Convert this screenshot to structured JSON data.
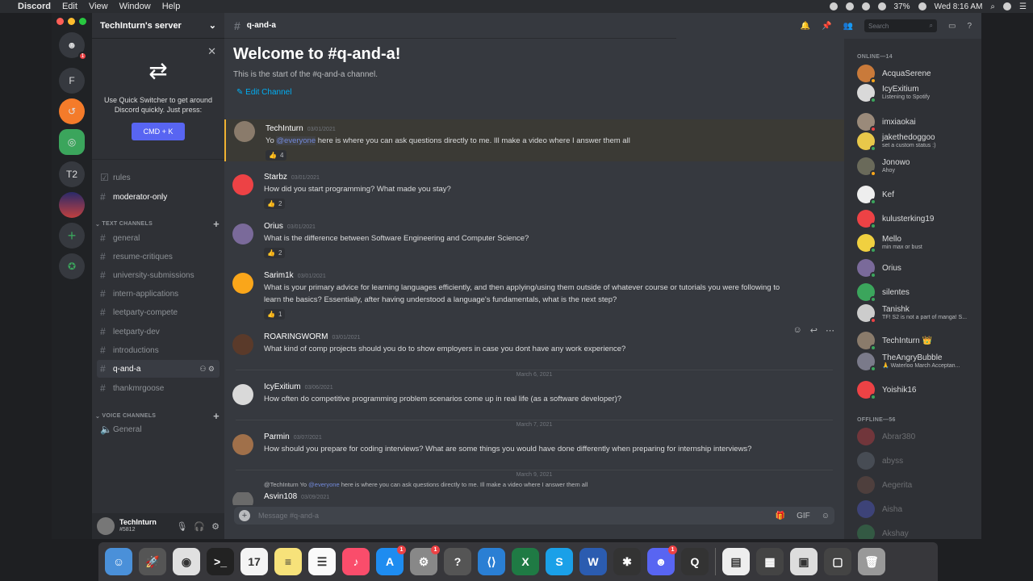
{
  "menubar": {
    "app": "Discord",
    "items": [
      "Edit",
      "View",
      "Window",
      "Help"
    ],
    "battery": "37%",
    "clock": "Wed 8:16 AM"
  },
  "rail": {
    "servers": [
      {
        "label": "",
        "badge": "1",
        "color": "#36393f"
      },
      {
        "label": "F",
        "badge": "",
        "color": "#36393f"
      },
      {
        "label": "",
        "badge": "",
        "color": "#f47b2a"
      },
      {
        "label": "",
        "badge": "",
        "color": "#3ba55c"
      },
      {
        "label": "T2",
        "badge": "",
        "color": "#36393f"
      },
      {
        "label": "",
        "badge": "",
        "color": "#b23a48"
      }
    ]
  },
  "sidebar": {
    "server_name": "TechInturn's server",
    "quick_switcher": {
      "text": "Use Quick Switcher to get around Discord quickly. Just press:",
      "button": "CMD + K"
    },
    "top_channels": [
      {
        "name": "rules"
      },
      {
        "name": "moderator-only"
      }
    ],
    "text_category": "TEXT CHANNELS",
    "text_channels": [
      {
        "name": "general"
      },
      {
        "name": "resume-critiques"
      },
      {
        "name": "university-submissions"
      },
      {
        "name": "intern-applications"
      },
      {
        "name": "leetparty-compete"
      },
      {
        "name": "leetparty-dev"
      },
      {
        "name": "introductions"
      },
      {
        "name": "q-and-a"
      },
      {
        "name": "thankmrgoose"
      }
    ],
    "voice_category": "VOICE CHANNELS",
    "voice_channels": [
      {
        "name": "General"
      }
    ],
    "user": {
      "name": "TechInturn",
      "tag": "#5812"
    }
  },
  "chat": {
    "channel": "q-and-a",
    "welcome_title": "Welcome to #q-and-a!",
    "welcome_sub": "This is the start of the #q-and-a channel.",
    "edit_channel": "Edit Channel",
    "messages": [
      {
        "author": "TechInturn",
        "date": "03/01/2021",
        "pre": "Yo ",
        "mention": "@everyone",
        "text": " here is where you can ask questions directly to me. Ill make a video where I answer them all",
        "reaction": "4",
        "avatar": "#8a7b6b"
      },
      {
        "author": "Starbz",
        "date": "03/01/2021",
        "pre": "",
        "mention": "",
        "text": "How did you start programming? What made you stay?",
        "reaction": "2",
        "avatar": "#ed4245"
      },
      {
        "author": "Orius",
        "date": "03/01/2021",
        "pre": "",
        "mention": "",
        "text": "What is the difference between Software Engineering and Computer Science?",
        "reaction": "2",
        "avatar": "#7a6a9a"
      },
      {
        "author": "Sarim1k",
        "date": "03/01/2021",
        "pre": "",
        "mention": "",
        "text": "What is your primary advice for learning languages efficiently, and then applying/using them outside of whatever course or tutorials you were following to learn the basics? Essentially, after having understood a language's fundamentals, what is the next step?",
        "reaction": "1",
        "avatar": "#faa61a"
      },
      {
        "author": "ROARINGWORM",
        "date": "03/01/2021",
        "pre": "",
        "mention": "",
        "text": "What kind of comp projects should you do to show employers in case you dont have any work experience?",
        "reaction": "",
        "avatar": "#5a3a2a"
      },
      {
        "author": "IcyExitium",
        "date": "03/06/2021",
        "pre": "",
        "mention": "",
        "text": "How often do competitive programming problem scenarios come up in real life (as a software developer)?",
        "reaction": "",
        "avatar": "#d9d9d9"
      },
      {
        "author": "Parmin",
        "date": "03/07/2021",
        "pre": "",
        "mention": "",
        "text": "How should you prepare for coding interviews? What are some things you would have done differently when preparing for internship interviews?",
        "reaction": "",
        "avatar": "#a0704a"
      },
      {
        "author": "Asvin108",
        "date": "03/09/2021",
        "pre": "",
        "mention": "",
        "text": "",
        "reaction": "",
        "avatar": "#6a6a6a"
      }
    ],
    "dividers": [
      "March 6, 2021",
      "March 7, 2021",
      "March 9, 2021"
    ],
    "reply_preview": {
      "author": "@TechInturn",
      "pre": " Yo ",
      "mention": "@everyone",
      "text": " here is where you can ask questions directly to me. Ill make a video where I answer them all"
    },
    "composer_placeholder": "Message #q-and-a"
  },
  "header_tools": {
    "search_placeholder": "Search"
  },
  "members": {
    "online_label": "ONLINE—14",
    "online": [
      {
        "name": "AcquaSerene",
        "status": "",
        "color": "#c97a3a",
        "dot": "#faa61a"
      },
      {
        "name": "IcyExitium",
        "status": "Listening to Spotify",
        "color": "#d9d9d9",
        "dot": "#3ba55c"
      },
      {
        "name": "imxiaokai",
        "status": "",
        "color": "#9a8a7a",
        "dot": "#ed4245"
      },
      {
        "name": "jakethedoggoo",
        "status": "set a custom status :)",
        "color": "#e8c84a",
        "dot": "#3ba55c"
      },
      {
        "name": "Jonowo",
        "status": "Ahoy",
        "color": "#6a6a5a",
        "dot": "#faa61a"
      },
      {
        "name": "Kef",
        "status": "",
        "color": "#eeeeee",
        "dot": "#3ba55c"
      },
      {
        "name": "kulusterking19",
        "status": "",
        "color": "#ed4245",
        "dot": "#3ba55c"
      },
      {
        "name": "Mello",
        "status": "min max or bust",
        "color": "#f0d040",
        "dot": "#3ba55c"
      },
      {
        "name": "Orius",
        "status": "",
        "color": "#7a6a9a",
        "dot": "#3ba55c"
      },
      {
        "name": "silentes",
        "status": "",
        "color": "#3ba55c",
        "dot": "#3ba55c"
      },
      {
        "name": "Tanishk",
        "status": "TF! S2 is not a part of manga! S...",
        "color": "#cccccc",
        "dot": "#ed4245"
      },
      {
        "name": "TechInturn 👑",
        "status": "",
        "color": "#8a7b6b",
        "dot": "#3ba55c"
      },
      {
        "name": "TheAngryBubble",
        "status": "🙏 Waterloo March Acceptan...",
        "color": "#7a7a8a",
        "dot": "#3ba55c"
      },
      {
        "name": "Yoishik16",
        "status": "",
        "color": "#ed4245",
        "dot": "#3ba55c"
      }
    ],
    "offline_label": "OFFLINE—56",
    "offline": [
      {
        "name": "Abrar380",
        "color": "#ed4245"
      },
      {
        "name": "abyss",
        "color": "#747f8d"
      },
      {
        "name": "Aegerita",
        "color": "#8a5a4a"
      },
      {
        "name": "Aisha",
        "color": "#5865f2"
      },
      {
        "name": "Akshay",
        "color": "#3ba55c"
      }
    ]
  },
  "dock": {
    "apps": [
      {
        "name": "finder-icon",
        "color": "#4a90d9",
        "glyph": "☺",
        "badge": ""
      },
      {
        "name": "launchpad-icon",
        "color": "#555",
        "glyph": "🚀",
        "badge": ""
      },
      {
        "name": "chrome-icon",
        "color": "#e0e0e0",
        "glyph": "◉",
        "badge": ""
      },
      {
        "name": "terminal-icon",
        "color": "#222",
        "glyph": ">_",
        "badge": ""
      },
      {
        "name": "calendar-icon",
        "color": "#f4f4f4",
        "glyph": "17",
        "badge": ""
      },
      {
        "name": "notes-icon",
        "color": "#f7e27a",
        "glyph": "≡",
        "badge": ""
      },
      {
        "name": "reminders-icon",
        "color": "#fafafa",
        "glyph": "☰",
        "badge": ""
      },
      {
        "name": "music-icon",
        "color": "#fa4d6b",
        "glyph": "♪",
        "badge": ""
      },
      {
        "name": "app-store-icon",
        "color": "#1e8cf0",
        "glyph": "A",
        "badge": "1"
      },
      {
        "name": "system-preferences-icon",
        "color": "#888",
        "glyph": "⚙",
        "badge": "1"
      },
      {
        "name": "help-icon",
        "color": "#555",
        "glyph": "?",
        "badge": ""
      },
      {
        "name": "vscode-icon",
        "color": "#2a7fd4",
        "glyph": "⟨⟩",
        "badge": ""
      },
      {
        "name": "excel-icon",
        "color": "#1f7a44",
        "glyph": "X",
        "badge": ""
      },
      {
        "name": "skype-icon",
        "color": "#1aa0e8",
        "glyph": "S",
        "badge": ""
      },
      {
        "name": "word-icon",
        "color": "#2b5cb0",
        "glyph": "W",
        "badge": ""
      },
      {
        "name": "davinci-icon",
        "color": "#333",
        "glyph": "✱",
        "badge": ""
      },
      {
        "name": "discord-icon",
        "color": "#5865f2",
        "glyph": "☻",
        "badge": "1"
      },
      {
        "name": "quicktime-icon",
        "color": "#333",
        "glyph": "Q",
        "badge": ""
      },
      {
        "name": "document-icon",
        "color": "#eee",
        "glyph": "▤",
        "badge": ""
      },
      {
        "name": "screenshot-icon",
        "color": "#444",
        "glyph": "▦",
        "badge": ""
      },
      {
        "name": "window-preview-icon",
        "color": "#ddd",
        "glyph": "▣",
        "badge": ""
      },
      {
        "name": "window-preview-2-icon",
        "color": "#444",
        "glyph": "▢",
        "badge": ""
      },
      {
        "name": "trash-icon",
        "color": "#999",
        "glyph": "🗑",
        "badge": ""
      }
    ]
  }
}
